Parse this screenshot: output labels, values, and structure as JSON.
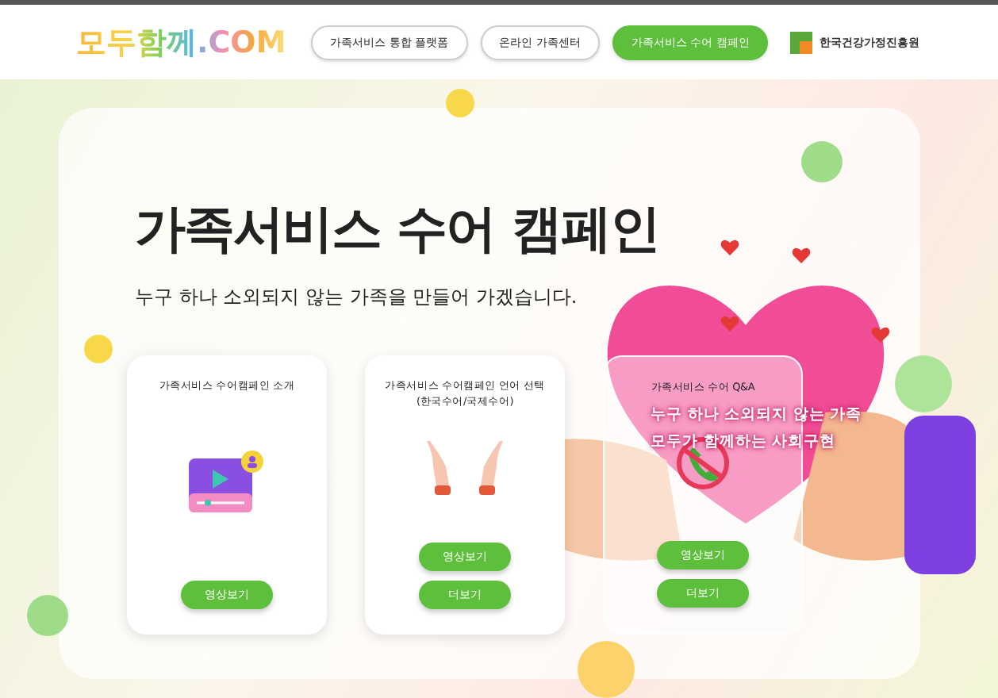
{
  "header": {
    "logo": "모두함께.COM",
    "nav": [
      {
        "label": "가족서비스 통합 플랫폼",
        "selected": false
      },
      {
        "label": "온라인 가족센터",
        "selected": false
      },
      {
        "label": "가족서비스 수어 캠페인",
        "selected": true
      }
    ],
    "org_logo": "한국건강가정진흥원"
  },
  "hero": {
    "title": "가족서비스 수어 캠페인",
    "subtitle": "누구 하나 소외되지 않는 가족을 만들어 가겠습니다.",
    "picture_caption": [
      "누구 하나 소외되지 않는 가족",
      "모두가 함께하는 사회구현"
    ]
  },
  "cards": [
    {
      "title": "가족서비스 수어캠페인 소개",
      "kind": "video",
      "translucent": false,
      "buttons": [
        "영상보기"
      ]
    },
    {
      "title": "가족서비스 수어캠페인 언어 선택\n(한국수어/국제수어)",
      "kind": "hands",
      "translucent": false,
      "buttons": [
        "영상보기",
        "더보기"
      ]
    },
    {
      "title": "가족서비스 수어 Q&A",
      "kind": "no-phone",
      "translucent": true,
      "buttons": [
        "영상보기",
        "더보기"
      ]
    }
  ]
}
